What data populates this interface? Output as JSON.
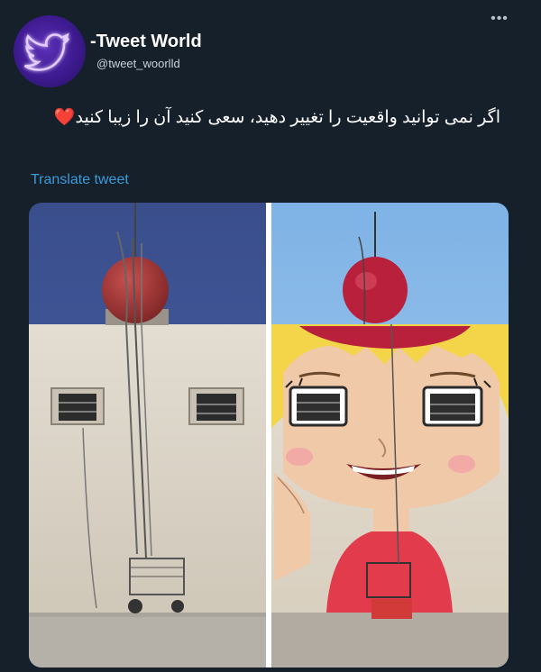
{
  "tweet": {
    "display_name": "-Tweet World",
    "handle": "@tweet_woorlld",
    "text": "اگر نمی توانید واقعیت را تغییر دهید، سعی کنید آن را زیبا کنید",
    "heart_emoji": "❤️",
    "translate_label": "Translate tweet",
    "more_icon": "more-horizontal-icon"
  },
  "avatar": {
    "icon": "twitter-bird-icon",
    "color": "#a56dff"
  },
  "media": {
    "description_icons": [
      "before-photo",
      "after-photo"
    ]
  },
  "colors": {
    "background": "#15202b",
    "link": "#3a9ad9",
    "text": "#ffffff",
    "secondary_text": "#c9d1d9"
  }
}
